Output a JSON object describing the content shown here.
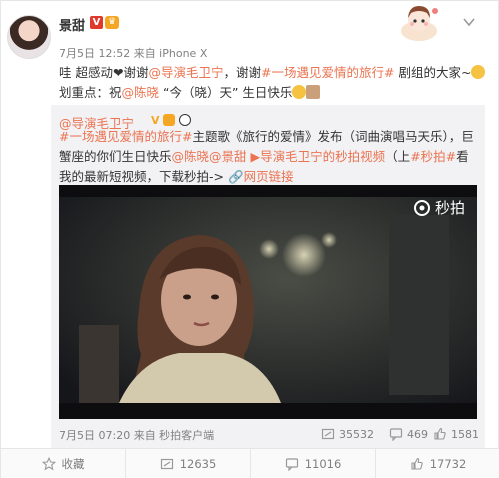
{
  "post": {
    "user_name": "景甜",
    "v_badge": "V",
    "crown_badge": "♛",
    "meta": "7月5日 12:52 来自 iPhone X",
    "text_prefix": "哇 超感动",
    "heart": "❤",
    "text_thanks1": "谢谢",
    "mention1": "@导演毛卫宁",
    "text_thanks2": "，谢谢",
    "topic1": "#一场遇见爱情的旅行#",
    "text_mid": " 剧组的大家~",
    "text_line2_a": " 划重点：祝",
    "mention2": "@陈晓",
    "text_line2_b": " “今（晓）天” 生日快乐"
  },
  "repost": {
    "author": "@导演毛卫宁",
    "badge_v": "V",
    "topic": "#一场遇见爱情的旅行#",
    "text_a": "主题歌《旅行的爱情》发布（词曲演唱马天乐），巨蟹座的你们生日快乐",
    "mention_a": "@陈晓",
    "mention_b": "@景甜",
    "video_link": "导演毛卫宁的秒拍视频",
    "text_b": "（上",
    "topic2": "#秒拍#",
    "text_c": "看我的最新短视频，下载秒拍->",
    "web_link": "网页链接",
    "video_watermark": "秒拍",
    "meta": "7月5日 07:20 来自 秒拍客户端",
    "stats": {
      "reposts": "35532",
      "comments": "469",
      "likes": "1581"
    }
  },
  "actions": {
    "favorite": "收藏",
    "repost": "12635",
    "comment": "11016",
    "like": "17732"
  },
  "colors": {
    "link": "#eb7350",
    "repost_bg": "#f2f2f5",
    "meta_text": "#808080"
  }
}
